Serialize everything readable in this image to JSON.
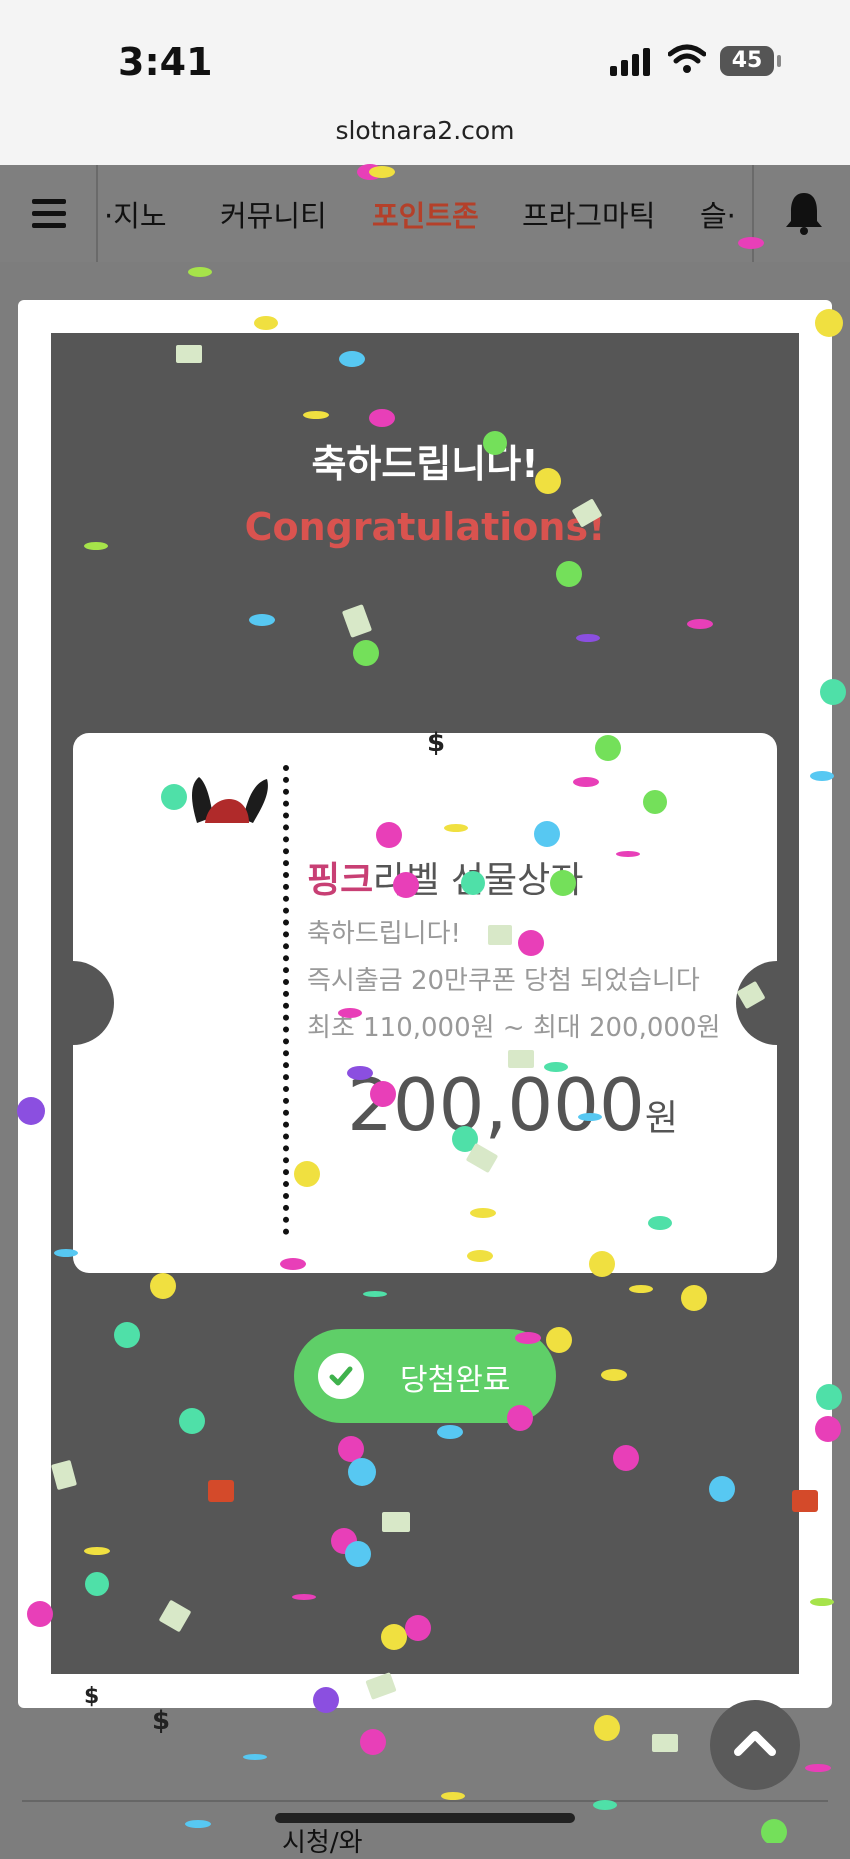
{
  "status_bar": {
    "time": "3:41",
    "battery": "45"
  },
  "browser": {
    "url": "slotnara2.com"
  },
  "nav": {
    "items": [
      "·지노",
      "커뮤니티",
      "포인트존",
      "프라그마틱",
      "슬·"
    ],
    "active_index": 2
  },
  "modal": {
    "title_ko": "축하드립니다!",
    "title_en": "Congratulations!",
    "ticket": {
      "title_highlight": "핑크",
      "title_rest": "라벨 선물상자",
      "line1": "축하드립니다!",
      "line2": "즉시출금 20만쿠폰 당첨 되었습니다",
      "line3": "최초 110,000원 ~ 최대 200,000원",
      "amount": "200,000",
      "amount_unit": "원"
    },
    "done_button": "당첨완료"
  },
  "bottom": {
    "partial_text": "시청/와"
  },
  "colors": {
    "active_nav": "#b4402a",
    "congrats_red": "#d9534f",
    "pink_label": "#c83f74",
    "success_green": "#5fcf68"
  },
  "icons": [
    "hamburger-icon",
    "bell-icon",
    "check-icon",
    "chevron-up-icon",
    "bunny-mascot-icon",
    "cellular-signal-icon",
    "wifi-icon"
  ]
}
